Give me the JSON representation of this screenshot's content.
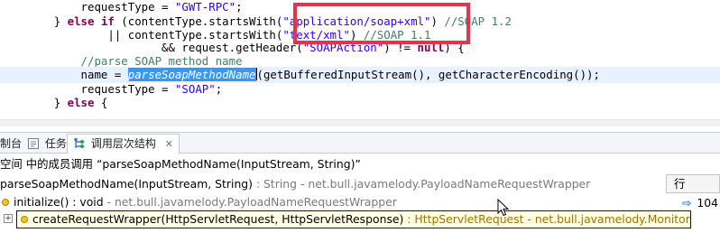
{
  "editor": {
    "lines": [
      {
        "indent": "            ",
        "parts": [
          {
            "t": "requestType = ",
            "c": ""
          },
          {
            "t": "\"GWT-RPC\"",
            "c": "str"
          },
          {
            "t": ";",
            "c": ""
          }
        ]
      },
      {
        "indent": "        ",
        "parts": [
          {
            "t": "} ",
            "c": ""
          },
          {
            "t": "else if",
            "c": "kw"
          },
          {
            "t": " (contentType.startsWith(",
            "c": ""
          },
          {
            "t": "\"application/soap+xml\"",
            "c": "str"
          },
          {
            "t": ") ",
            "c": ""
          },
          {
            "t": "//SOAP 1.2",
            "c": "cmt"
          }
        ]
      },
      {
        "indent": "                ",
        "parts": [
          {
            "t": "|| contentType.startsWith(",
            "c": ""
          },
          {
            "t": "\"text/xml\"",
            "c": "str"
          },
          {
            "t": ") ",
            "c": ""
          },
          {
            "t": "//SOAP 1.1",
            "c": "cmt"
          }
        ]
      },
      {
        "indent": "                        ",
        "parts": [
          {
            "t": "&& request.getHeader(",
            "c": ""
          },
          {
            "t": "\"SOAPAction\"",
            "c": "str"
          },
          {
            "t": ") != ",
            "c": ""
          },
          {
            "t": "null",
            "c": "kw"
          },
          {
            "t": ") {",
            "c": ""
          }
        ]
      },
      {
        "indent": "            ",
        "parts": [
          {
            "t": "//parse SOAP method name",
            "c": "cmt"
          }
        ]
      },
      {
        "indent": "            ",
        "parts": [
          {
            "t": "name = ",
            "c": ""
          },
          {
            "t": "parseSoapMethodName",
            "c": "sel"
          },
          {
            "t": "(getBufferedInputStream(), getCharacterEncoding());",
            "c": ""
          }
        ],
        "current": true
      },
      {
        "indent": "            ",
        "parts": [
          {
            "t": "requestType = ",
            "c": ""
          },
          {
            "t": "\"SOAP\"",
            "c": "str"
          },
          {
            "t": ";",
            "c": ""
          }
        ]
      },
      {
        "indent": "        ",
        "parts": [
          {
            "t": "} ",
            "c": ""
          },
          {
            "t": "else",
            "c": "kw"
          },
          {
            "t": " {",
            "c": ""
          }
        ]
      }
    ]
  },
  "tabs": [
    {
      "label": "制台",
      "icon": "console-icon",
      "active": false
    },
    {
      "label": "任务",
      "icon": "tasks-icon",
      "active": false
    },
    {
      "label": "调用层次结构",
      "icon": "call-hierarchy-icon",
      "active": true
    }
  ],
  "hierarchy": {
    "caption": "空间 中的成员调用 “parseSoapMethodName(InputStream, String)”",
    "root": {
      "signature": "parseSoapMethodName(InputStream, String)",
      "detail": " : String - net.bull.javamelody.PayloadNameRequestWrapper"
    },
    "column_header": "行",
    "rows": [
      {
        "method": "initialize() : void",
        "qualifier": " - net.bull.javamelody.PayloadNameRequestWrapper",
        "line": "104"
      }
    ],
    "tooltip": {
      "method": "createRequestWrapper(HttpServletRequest, HttpServletResponse)",
      "type": " : HttpServletRequest - net.bull.javamelody.MonitoringFilter"
    }
  },
  "colors": {
    "highlight_box": "#e8314b",
    "selection": "#3399ff",
    "keyword": "#7f0055",
    "string": "#2a00ff",
    "comment": "#3f7f5f",
    "tooltip_bg": "#ffffe1"
  }
}
